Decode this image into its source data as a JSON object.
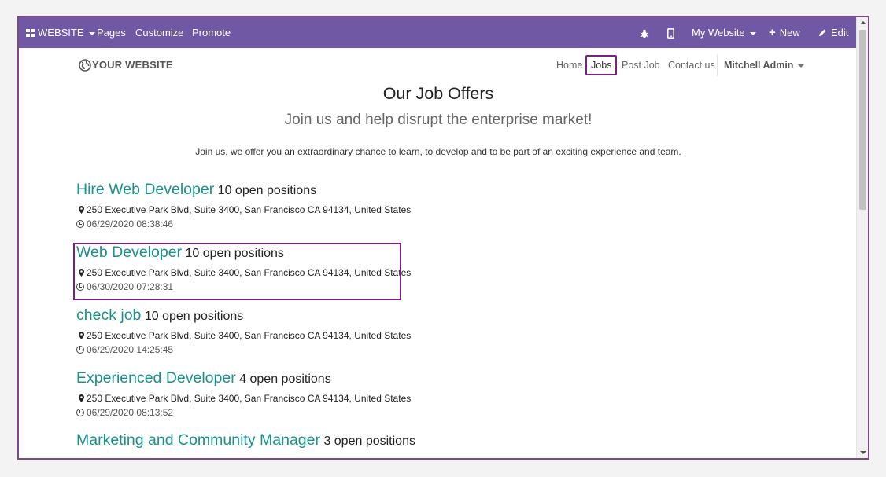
{
  "topbar": {
    "website_label": "WEBSITE",
    "menu": [
      "Pages",
      "Customize",
      "Promote"
    ],
    "site_selector": "My Website",
    "new_label": "New",
    "edit_label": "Edit"
  },
  "header": {
    "logo_text": "YOUR WEBSITE",
    "nav": [
      "Home",
      "Jobs",
      "Post Job",
      "Contact us"
    ],
    "user": "Mitchell Admin",
    "active_nav": "Jobs"
  },
  "content": {
    "title": "Our Job Offers",
    "subtitle": "Join us and help disrupt the enterprise market!",
    "intro": "Join us, we offer you an extraordinary chance to learn, to develop and to be part of an exciting experience and team."
  },
  "jobs": [
    {
      "title": "Hire Web Developer",
      "positions": "10 open positions",
      "address": "250 Executive Park Blvd, Suite 3400, San Francisco CA 94134, United States",
      "date": "06/29/2020 08:38:46"
    },
    {
      "title": "Web Developer",
      "positions": "10 open positions",
      "address": "250 Executive Park Blvd, Suite 3400, San Francisco CA 94134, United States",
      "date": "06/30/2020 07:28:31"
    },
    {
      "title": "check job",
      "positions": "10 open positions",
      "address": "250 Executive Park Blvd, Suite 3400, San Francisco CA 94134, United States",
      "date": "06/29/2020 14:25:45"
    },
    {
      "title": "Experienced Developer",
      "positions": "4 open positions",
      "address": "250 Executive Park Blvd, Suite 3400, San Francisco CA 94134, United States",
      "date": "06/29/2020 08:13:52"
    },
    {
      "title": "Marketing and Community Manager",
      "positions": "3 open positions"
    }
  ],
  "colors": {
    "topbar": "#7158a4",
    "highlight": "#7a2180",
    "job_title": "#17928d"
  }
}
